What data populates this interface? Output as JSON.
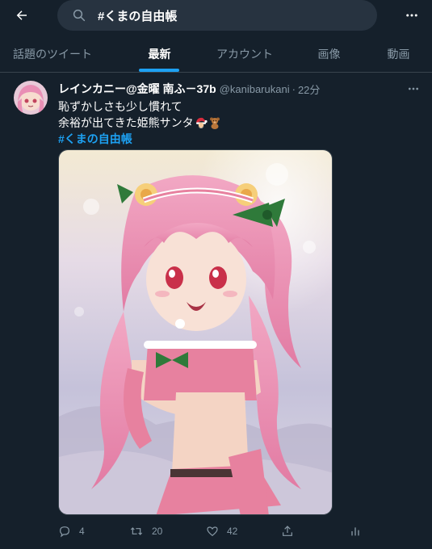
{
  "search": {
    "query": "#くまの自由帳"
  },
  "tabs": [
    {
      "label": "話題のツイート",
      "active": false
    },
    {
      "label": "最新",
      "active": true
    },
    {
      "label": "アカウント",
      "active": false
    },
    {
      "label": "画像",
      "active": false
    },
    {
      "label": "動画",
      "active": false
    }
  ],
  "tweet": {
    "author_name": "レインカニー@金曜 南ふ－37b",
    "author_handle": "@kanibarukani",
    "separator": "·",
    "time": "22分",
    "text_line1": "恥ずかしさも少し慣れて",
    "text_line2": "余裕が出てきた姫熊サンタ",
    "hashtag": "#くまの自由帳",
    "emojis": [
      "santa-claus",
      "teddy-bear"
    ],
    "actions": {
      "reply_count": "4",
      "retweet_count": "20",
      "like_count": "42"
    }
  },
  "colors": {
    "background": "#15202b",
    "accent": "#1da1f2",
    "secondary_text": "#8899a6",
    "search_bg": "#273340",
    "divider": "#38444d"
  },
  "icons": [
    "back-arrow-icon",
    "search-icon",
    "more-icon",
    "reply-icon",
    "retweet-icon",
    "like-icon",
    "share-icon",
    "analytics-icon"
  ]
}
